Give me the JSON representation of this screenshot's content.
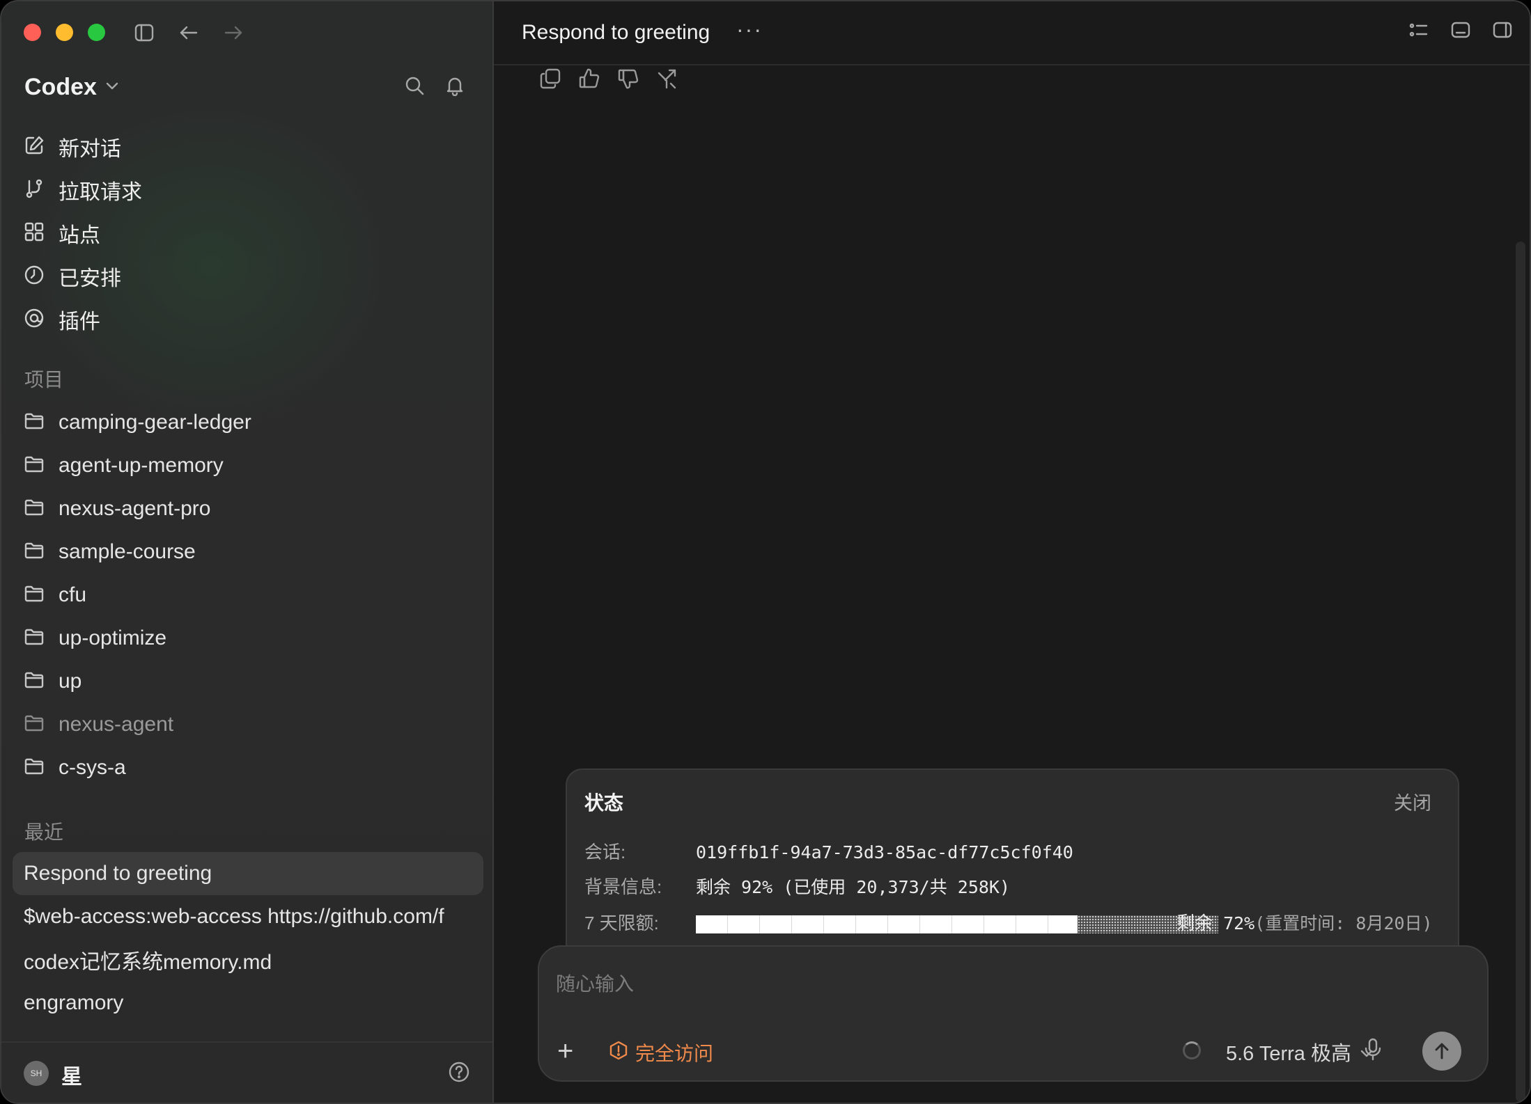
{
  "sidebar": {
    "brand": "Codex",
    "nav": [
      {
        "label": "新对话",
        "icon": "compose-icon"
      },
      {
        "label": "拉取请求",
        "icon": "pull-request-icon"
      },
      {
        "label": "站点",
        "icon": "grid-icon"
      },
      {
        "label": "已安排",
        "icon": "clock-icon"
      },
      {
        "label": "插件",
        "icon": "plugin-icon"
      }
    ],
    "projects_title": "项目",
    "projects": [
      "camping-gear-ledger",
      "agent-up-memory",
      "nexus-agent-pro",
      "sample-course",
      "cfu",
      "up-optimize",
      "up",
      "nexus-agent",
      "c-sys-a"
    ],
    "recent_title": "最近",
    "recent": [
      "Respond to greeting",
      "$web-access:web-access https://github.com/f",
      "codex记忆系统memory.md",
      "engramory"
    ],
    "user": {
      "initials": "SH",
      "name": "星"
    }
  },
  "main": {
    "title": "Respond to greeting",
    "more": "···"
  },
  "status": {
    "title": "状态",
    "close": "关闭",
    "session_label": "会话:",
    "session_value": "019ffb1f-94a7-73d3-85ac-df77c5cf0f40",
    "context_label": "背景信息:",
    "context_value": "剩余 92% (已使用 20,373/共 258K)",
    "limit_label": "7 天限额:",
    "limit_remaining_text": "剩余",
    "limit_percent": "72%",
    "limit_reset": "(重置时间: 8月20日)",
    "limit_fill_fraction": 0.73
  },
  "composer": {
    "placeholder": "随心输入",
    "access_label": "完全访问",
    "model_label": "5.6 Terra 极高"
  },
  "colors": {
    "accent_warning": "#f08a4b",
    "sidebar_bg": "#2b2b2b",
    "main_bg": "#1a1a1a"
  }
}
